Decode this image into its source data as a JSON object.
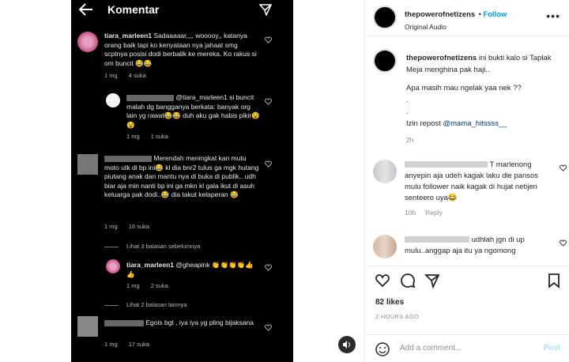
{
  "phone": {
    "title": "Komentar",
    "comments": [
      {
        "user": "tiara_marleen1",
        "text": "Sadaaaaar,,,, wooooy,, katanya orang baik tapi ko kenyataan nya jahaat smg scptnya posisi dodi berbalik ke mereka. Ko rakus si om buncit 😂😂",
        "time": "1 mg",
        "likes": "4 suka"
      },
      {
        "user": "@tiara_marleen1",
        "text": "si buncit malah dg bangganya berkata: banyak org lain yg rawat😂😂 duh aku gak habis pikir😵😵",
        "time": "1 mg",
        "likes": "1 suka"
      },
      {
        "text": "Merendah meningkat kan mutu moto utk di bp ini😂 kl dia bnr2 tulus ga mgk hutang piutang anak dan mantu nya di buka di publik.. udh biar aja min nanti bp ini ga mkn kl gala ikut di asuh keluarga pak dodi..😂 dia takut kelaperan 😂",
        "time": "1 mg",
        "likes": "16 suka"
      },
      {
        "user": "tiara_marleen1",
        "text": "@gheapink 👏👏👏👏👍👍",
        "time": "1 mg",
        "likes": "2 suka"
      },
      {
        "text": "Egois bgt , iya iya yg pling bijaksana",
        "time": "1 mg",
        "likes": "17 suka"
      }
    ],
    "thread1": "Lihat 3 balasan sebelumnya",
    "thread2": "Lihat 2 balasan lainnya"
  },
  "post": {
    "username": "thepowerofnetizens",
    "follow": "Follow",
    "audio": "Original Audio",
    "caption_user": "thepowerofnetizens",
    "caption_line1": "ini bukti kalo si Taplak Meja menghina pak haji..",
    "caption_line2": "Apa masih mau ngelak yaa nek ??",
    "caption_dot1": ".",
    "caption_dot2": ".",
    "caption_repost": "Izin repost",
    "caption_tag": "@mama_hitssss__",
    "caption_time": "2h",
    "replies": [
      {
        "text": "T marlenong anyepin aja udeh kagak laku die pansos mulu follower naik kagak di hujat netijen senteero uya😂",
        "time": "10h",
        "reply": "Reply"
      },
      {
        "text": "udhlah jgn di up mulu..anggap aja itu ya ngomong"
      }
    ],
    "likes": "82 likes",
    "ago": "2 HOURS AGO",
    "add_placeholder": "Add a comment...",
    "post_btn": "Post"
  },
  "colors": {
    "accent": "#0095f6",
    "dark": "#000000"
  }
}
